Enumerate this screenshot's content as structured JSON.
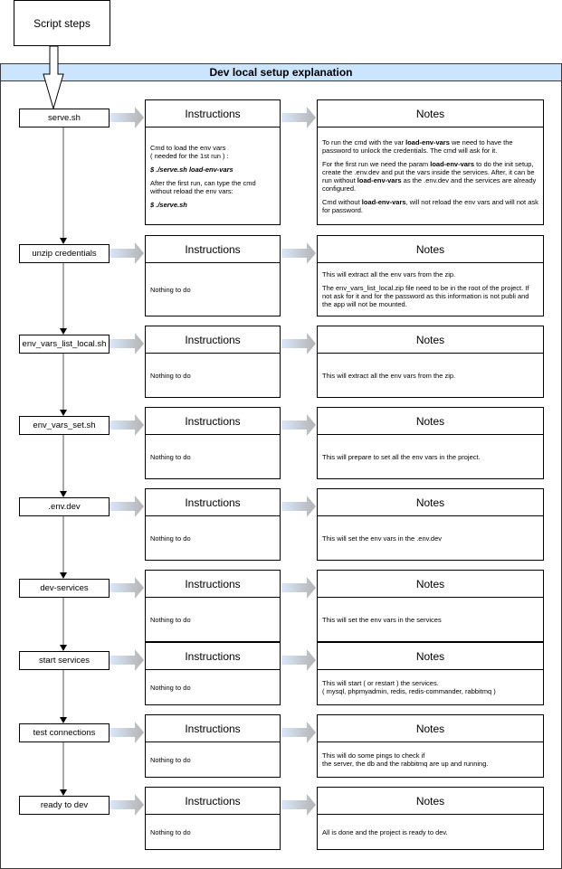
{
  "diagram": {
    "start_label": "Script steps",
    "pool_title": "Dev local setup explanation",
    "instructions_title": "Instructions",
    "notes_title": "Notes",
    "steps": [
      {
        "label": "serve.sh",
        "instructions": [
          {
            "text": "Cmd to load the env vars\n( needed for the 1st run ) :"
          },
          {
            "text": "$ ./serve.sh load-env-vars",
            "style": "cmd"
          },
          {
            "text": "After the first run, can type the cmd\nwithout reload the env vars:"
          },
          {
            "text": "$ ./serve.sh",
            "style": "cmd"
          }
        ],
        "notes": [
          {
            "parts": [
              {
                "t": "To run the cmd with the var "
              },
              {
                "t": "load-env-vars",
                "b": true
              },
              {
                "t": " we need to have the password to unlock the credentials. The cmd will ask for it."
              }
            ]
          },
          {
            "parts": [
              {
                "t": "For the first run we need the param "
              },
              {
                "t": "load-env-vars",
                "b": true
              },
              {
                "t": " to do the init setup, create the .env.dev and put the vars inside the services. After, it can be run without "
              },
              {
                "t": "load-env-vars",
                "b": true
              },
              {
                "t": " as the .env.dev and the services are already configured."
              }
            ]
          },
          {
            "parts": [
              {
                "t": "Cmd without "
              },
              {
                "t": "load-env-vars",
                "b": true
              },
              {
                "t": ", will not reload the env vars and will not ask for password."
              }
            ]
          }
        ]
      },
      {
        "label": "unzip credentials",
        "instructions": [
          {
            "text": "Nothing to do"
          }
        ],
        "notes": [
          {
            "parts": [
              {
                "t": "This will extract all the env vars from the zip."
              }
            ]
          },
          {
            "parts": [
              {
                "t": "The env_vars_list_local.zip file need to be in the root of the project. If not ask for it and for the password as this information is not publi and the app will not be mounted."
              }
            ]
          }
        ]
      },
      {
        "label": "env_vars_list_local.sh",
        "instructions": [
          {
            "text": "Nothing to do"
          }
        ],
        "notes": [
          {
            "parts": [
              {
                "t": "This will extract all the env vars from the zip."
              }
            ]
          }
        ]
      },
      {
        "label": "env_vars_set.sh",
        "instructions": [
          {
            "text": "Nothing to do"
          }
        ],
        "notes": [
          {
            "parts": [
              {
                "t": "This will prepare to set all the env vars in the project."
              }
            ]
          }
        ]
      },
      {
        "label": ".env.dev",
        "instructions": [
          {
            "text": "Nothing to do"
          }
        ],
        "notes": [
          {
            "parts": [
              {
                "t": "This will set the env vars in the .env.dev"
              }
            ]
          }
        ]
      },
      {
        "label": "dev-services",
        "instructions": [
          {
            "text": "Nothing to do"
          }
        ],
        "notes": [
          {
            "parts": [
              {
                "t": "This will set the env vars in the services"
              }
            ]
          }
        ]
      },
      {
        "label": "start services",
        "instructions": [
          {
            "text": "Nothing to do"
          }
        ],
        "notes": [
          {
            "parts": [
              {
                "t": "This will start ( or restart ) the services.\n( mysql, phpmyadmin, redis, redis-commander, rabbitmq )"
              }
            ]
          }
        ]
      },
      {
        "label": "test connections",
        "instructions": [
          {
            "text": "Nothing to do"
          }
        ],
        "notes": [
          {
            "parts": [
              {
                "t": "This will do some pings to check if\nthe server, the db and the rabbitmq are up and running."
              }
            ]
          }
        ]
      },
      {
        "label": "ready to dev",
        "instructions": [
          {
            "text": "Nothing to do"
          }
        ],
        "notes": [
          {
            "parts": [
              {
                "t": "All is done and the project is ready to dev."
              }
            ]
          }
        ]
      }
    ]
  }
}
